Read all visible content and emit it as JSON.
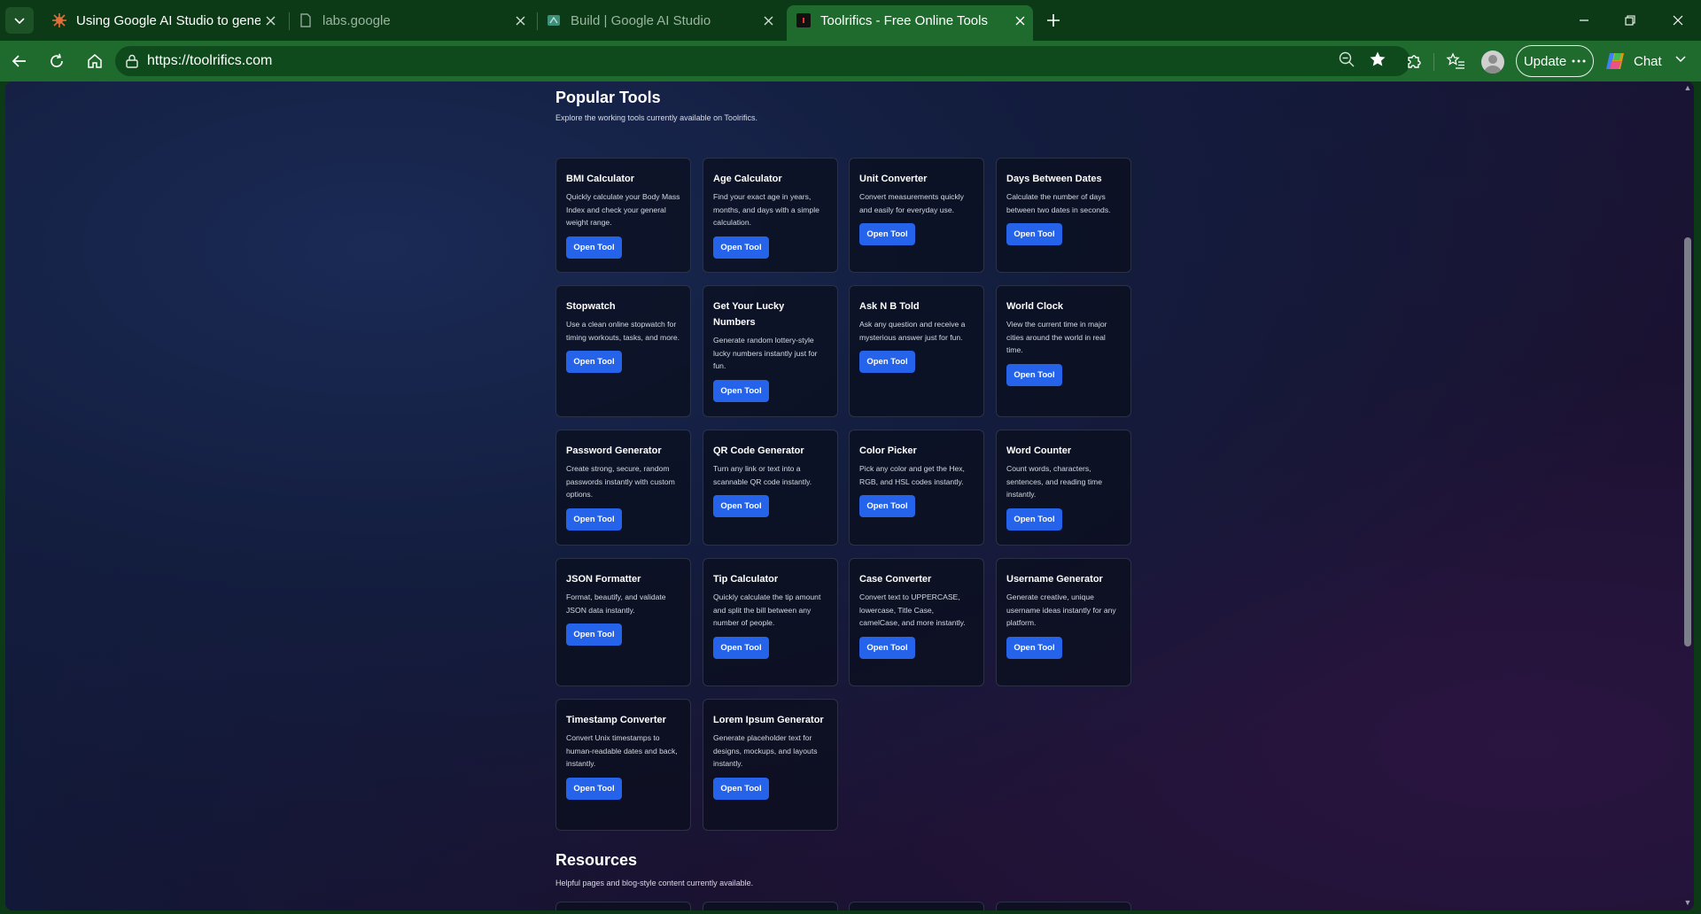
{
  "browser": {
    "tabs": [
      {
        "title": "Using Google AI Studio to generat",
        "active": false
      },
      {
        "title": "labs.google",
        "active": false
      },
      {
        "title": "Build | Google AI Studio",
        "active": false
      },
      {
        "title": "Toolrifics - Free Online Tools",
        "active": true
      }
    ],
    "url": "https://toolrifics.com",
    "update_label": "Update",
    "chat_label": "Chat"
  },
  "popular": {
    "title": "Popular Tools",
    "subtitle": "Explore the working tools currently available on Toolrifics.",
    "cards": [
      {
        "title": "BMI Calculator",
        "desc": "Quickly calculate your Body Mass Index and check your general weight range.",
        "button": "Open Tool"
      },
      {
        "title": "Age Calculator",
        "desc": "Find your exact age in years, months, and days with a simple calculation.",
        "button": "Open Tool"
      },
      {
        "title": "Unit Converter",
        "desc": "Convert measurements quickly and easily for everyday use.",
        "button": "Open Tool"
      },
      {
        "title": "Days Between Dates",
        "desc": "Calculate the number of days between two dates in seconds.",
        "button": "Open Tool"
      },
      {
        "title": "Stopwatch",
        "desc": "Use a clean online stopwatch for timing workouts, tasks, and more.",
        "button": "Open Tool"
      },
      {
        "title": "Get Your Lucky Numbers",
        "desc": "Generate random lottery-style lucky numbers instantly just for fun.",
        "button": "Open Tool"
      },
      {
        "title": "Ask N B Told",
        "desc": "Ask any question and receive a mysterious answer just for fun.",
        "button": "Open Tool"
      },
      {
        "title": "World Clock",
        "desc": "View the current time in major cities around the world in real time.",
        "button": "Open Tool"
      },
      {
        "title": "Password Generator",
        "desc": "Create strong, secure, random passwords instantly with custom options.",
        "button": "Open Tool"
      },
      {
        "title": "QR Code Generator",
        "desc": "Turn any link or text into a scannable QR code instantly.",
        "button": "Open Tool"
      },
      {
        "title": "Color Picker",
        "desc": "Pick any color and get the Hex, RGB, and HSL codes instantly.",
        "button": "Open Tool"
      },
      {
        "title": "Word Counter",
        "desc": "Count words, characters, sentences, and reading time instantly.",
        "button": "Open Tool"
      },
      {
        "title": "JSON Formatter",
        "desc": "Format, beautify, and validate JSON data instantly.",
        "button": "Open Tool"
      },
      {
        "title": "Tip Calculator",
        "desc": "Quickly calculate the tip amount and split the bill between any number of people.",
        "button": "Open Tool"
      },
      {
        "title": "Case Converter",
        "desc": "Convert text to UPPERCASE, lowercase, Title Case, camelCase, and more instantly.",
        "button": "Open Tool"
      },
      {
        "title": "Username Generator",
        "desc": "Generate creative, unique username ideas instantly for any platform.",
        "button": "Open Tool"
      },
      {
        "title": "Timestamp Converter",
        "desc": "Convert Unix timestamps to human-readable dates and back, instantly.",
        "button": "Open Tool"
      },
      {
        "title": "Lorem Ipsum Generator",
        "desc": "Generate placeholder text for designs, mockups, and layouts instantly.",
        "button": "Open Tool"
      }
    ]
  },
  "resources": {
    "title": "Resources",
    "subtitle": "Helpful pages and blog-style content currently available."
  },
  "colors": {
    "accent_button": "#2563eb",
    "browser_frame": "#1f6b2e"
  }
}
